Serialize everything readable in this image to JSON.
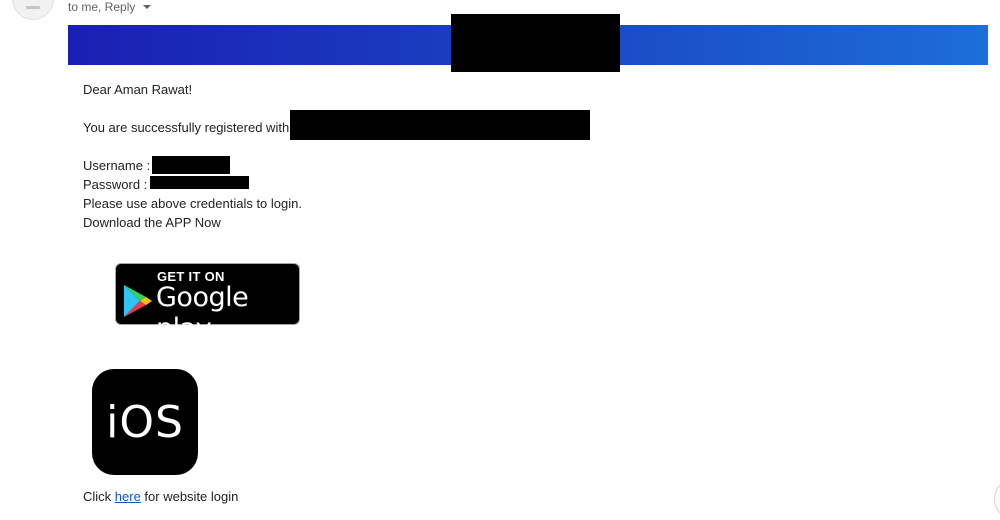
{
  "header": {
    "recipient_line": "to me, Reply"
  },
  "email": {
    "greeting": "Dear Aman Rawat!",
    "registered_text": "You are successfully registered with",
    "username_label": "Username :",
    "password_label": "Password :",
    "instructions": "Please use above credentials to login.",
    "download_text": "Download the APP Now",
    "footer_prefix": "Click ",
    "footer_link": "here",
    "footer_suffix": " for website login"
  },
  "badges": {
    "google_play_small": "GET IT ON",
    "google_play_big": "Google play",
    "ios_label": "iOS"
  },
  "colors": {
    "banner_start": "#1a1fb3",
    "banner_end": "#1c6ed8",
    "link": "#1155cc"
  }
}
